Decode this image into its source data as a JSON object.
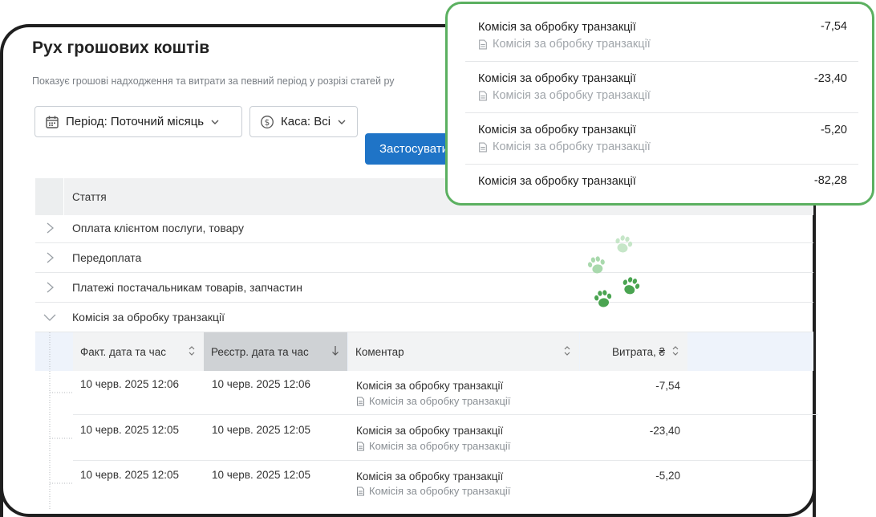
{
  "page": {
    "title": "Рух грошових коштів",
    "subtitle": "Показує грошові надходження та витрати за певний період у розрізі статей ру"
  },
  "filters": {
    "period_label": "Період: Поточний місяць",
    "cash_label": "Каса: Всі",
    "apply_label": "Застосувати"
  },
  "table": {
    "header": "Стаття",
    "rows": [
      {
        "label": "Оплата клієнтом послуги, товару",
        "expanded": false
      },
      {
        "label": "Передоплата",
        "expanded": false
      },
      {
        "label": "Платежі постачальникам товарів, запчастин",
        "expanded": false
      },
      {
        "label": "Комісія за обробку транзакції",
        "expanded": true
      }
    ]
  },
  "detail": {
    "columns": [
      "Факт. дата та час",
      "Реєстр. дата та час",
      "Коментар",
      "Витрата, ₴"
    ],
    "rows": [
      {
        "fact": "10 черв. 2025 12:06",
        "reg": "10 черв. 2025 12:06",
        "comment": "Комісія за обробку транзакції",
        "note": "Комісія за обробку транзакції",
        "amount": "-7,54"
      },
      {
        "fact": "10 черв. 2025 12:05",
        "reg": "10 черв. 2025 12:05",
        "comment": "Комісія за обробку транзакції",
        "note": "Комісія за обробку транзакції",
        "amount": "-23,40"
      },
      {
        "fact": "10 черв. 2025 12:05",
        "reg": "10 черв. 2025 12:05",
        "comment": "Комісія за обробку транзакції",
        "note": "Комісія за обробку транзакції",
        "amount": "-5,20"
      }
    ]
  },
  "overlay": {
    "rows": [
      {
        "title": "Комісія за обробку транзакції",
        "note": "Комісія за обробку транзакції",
        "amount": "-7,54"
      },
      {
        "title": "Комісія за обробку транзакції",
        "note": "Комісія за обробку транзакції",
        "amount": "-23,40"
      },
      {
        "title": "Комісія за обробку транзакції",
        "note": "Комісія за обробку транзакції",
        "amount": "-5,20"
      },
      {
        "title": "Комісія за обробку транзакції",
        "amount": "-82,28"
      }
    ]
  },
  "colors": {
    "accent": "#1f74c7",
    "highlight_border": "#5bb060",
    "paw_dark": "#4aa451",
    "paw_light": "#a9d9ad"
  }
}
